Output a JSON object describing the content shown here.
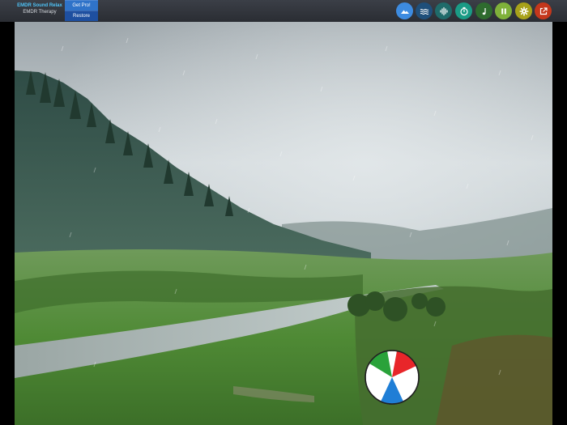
{
  "app": {
    "title": "EMDR Sound Relax",
    "subtitle": "EMDR Therapy"
  },
  "header": {
    "get_pro_label": "Get Pro!",
    "restore_label": "Restore"
  },
  "toolbar": {
    "buttons": [
      {
        "icon": "landscape-icon",
        "color": "#3d8be0"
      },
      {
        "icon": "waves-icon",
        "color": "#1f4f7a"
      },
      {
        "icon": "soundwave-icon",
        "color": "#1f6b6a"
      },
      {
        "icon": "timer-icon",
        "color": "#1a9b85"
      },
      {
        "icon": "music-note-icon",
        "color": "#2e6b2e"
      },
      {
        "icon": "pause-icon",
        "color": "#7fb13a"
      },
      {
        "icon": "gear-icon",
        "color": "#a8a21a"
      },
      {
        "icon": "external-link-icon",
        "color": "#c4371c"
      }
    ]
  },
  "scene": {
    "name": "rainy-valley-background"
  },
  "ball": {
    "colors": [
      "#e8262a",
      "#1f7ed6",
      "#2aa23a",
      "#ffffff"
    ]
  }
}
